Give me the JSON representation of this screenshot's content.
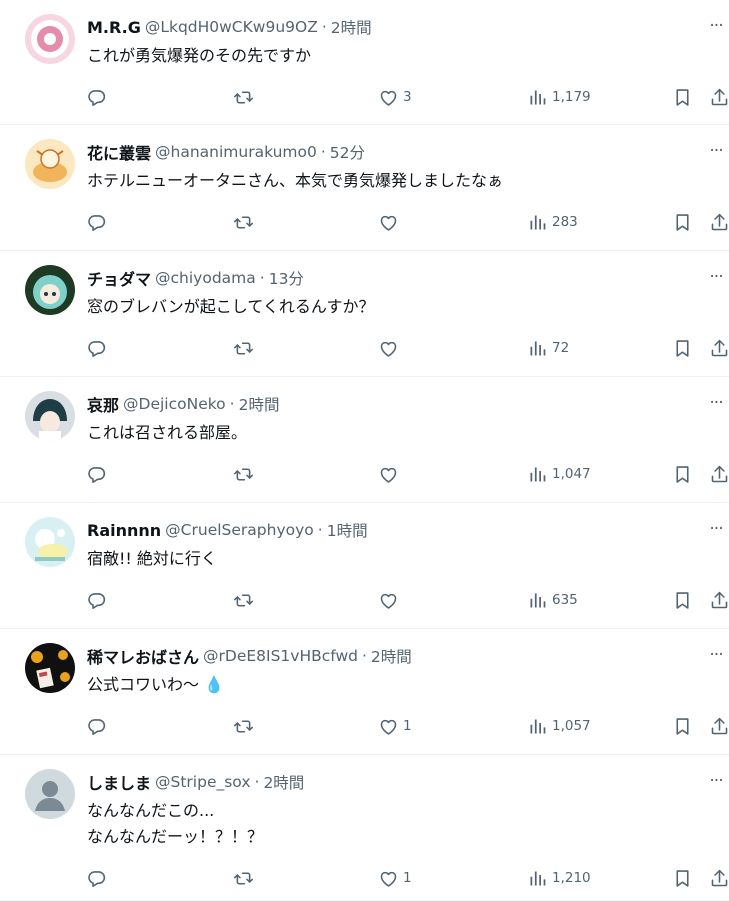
{
  "more_label": "···",
  "tweets": [
    {
      "name": "M.R.G",
      "handle": "@LkqdH0wCKw9u9OZ",
      "time": "2時間",
      "text": "これが勇気爆発のその先ですか",
      "likes": "3",
      "views": "1,179",
      "avatar": "pink-circle-avatar"
    },
    {
      "name": "花に叢雲",
      "handle": "@hananimurakumo0",
      "time": "52分",
      "text": "ホテルニューオータニさん、本気で勇気爆発しましたなぁ",
      "likes": "",
      "views": "283",
      "avatar": "illustration-avatar"
    },
    {
      "name": "チョダマ",
      "handle": "@chiyodama",
      "time": "13分",
      "text": "窓のブレバンが起こしてくれるんすか？",
      "likes": "",
      "views": "72",
      "avatar": "anime-character-avatar"
    },
    {
      "name": "哀那",
      "handle": "@DejicoNeko",
      "time": "2時間",
      "text": "これは召される部屋。",
      "likes": "",
      "views": "1,047",
      "avatar": "anime-character-avatar"
    },
    {
      "name": "Rainnnn",
      "handle": "@CruelSeraphyoyo",
      "time": "1時間",
      "text": "宿敵!! 絶対に行く",
      "likes": "",
      "views": "635",
      "avatar": "cartoon-avatar"
    },
    {
      "name": "稀マレおばさん",
      "handle": "@rDeE8IS1vHBcfwd",
      "time": "2時間",
      "text": "公式コワいわ〜 💧",
      "likes": "1",
      "views": "1,057",
      "avatar": "photo-avatar"
    },
    {
      "name": "しましま",
      "handle": "@Stripe_sox",
      "time": "2時間",
      "text": "なんなんだこの...\nなんなんだーッ！？！？",
      "likes": "1",
      "views": "1,210",
      "avatar": "default-avatar"
    }
  ],
  "colors": {
    "muted": "#536471",
    "text": "#0f1419",
    "border": "#eff3f4"
  },
  "icons": [
    "reply-icon",
    "retweet-icon",
    "like-icon",
    "views-icon",
    "bookmark-icon",
    "share-icon",
    "more-icon"
  ]
}
